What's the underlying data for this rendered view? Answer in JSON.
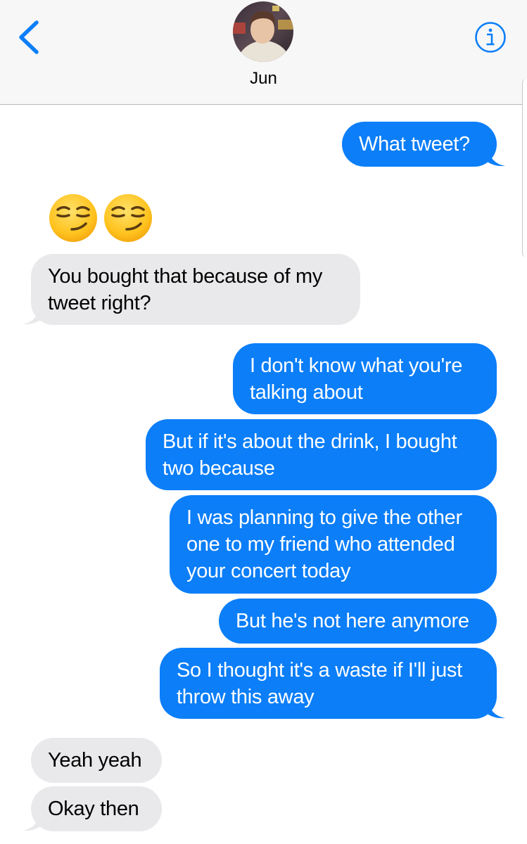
{
  "header": {
    "contact_name": "Jun"
  },
  "icons": {
    "back": "chevron-left-icon",
    "info": "info-icon",
    "avatar": "contact-photo"
  },
  "colors": {
    "sent_bubble": "#0b7ef8",
    "received_bubble": "#e9e9eb",
    "accent": "#0b7ef8"
  },
  "messages": [
    {
      "from": "me",
      "text_lines": [
        "What tweet?"
      ]
    },
    {
      "from": "them",
      "emoji": "smirking-face x2"
    },
    {
      "from": "them",
      "text_lines": [
        "You bought that because of my",
        "tweet right?"
      ]
    },
    {
      "from": "me",
      "text_lines": [
        "I don't know what you're",
        "talking about"
      ]
    },
    {
      "from": "me",
      "text_lines": [
        "But if it's about the drink, I bought",
        "two because"
      ]
    },
    {
      "from": "me",
      "text_lines": [
        "I was planning to give the other",
        "one to my friend who attended",
        "your concert today"
      ]
    },
    {
      "from": "me",
      "text_lines": [
        "But he's not here anymore"
      ]
    },
    {
      "from": "me",
      "text_lines": [
        "So I thought it's a waste if I'll just",
        "throw this away"
      ]
    },
    {
      "from": "them",
      "text_lines": [
        "Yeah yeah"
      ]
    },
    {
      "from": "them",
      "text_lines": [
        "Okay then"
      ]
    }
  ]
}
